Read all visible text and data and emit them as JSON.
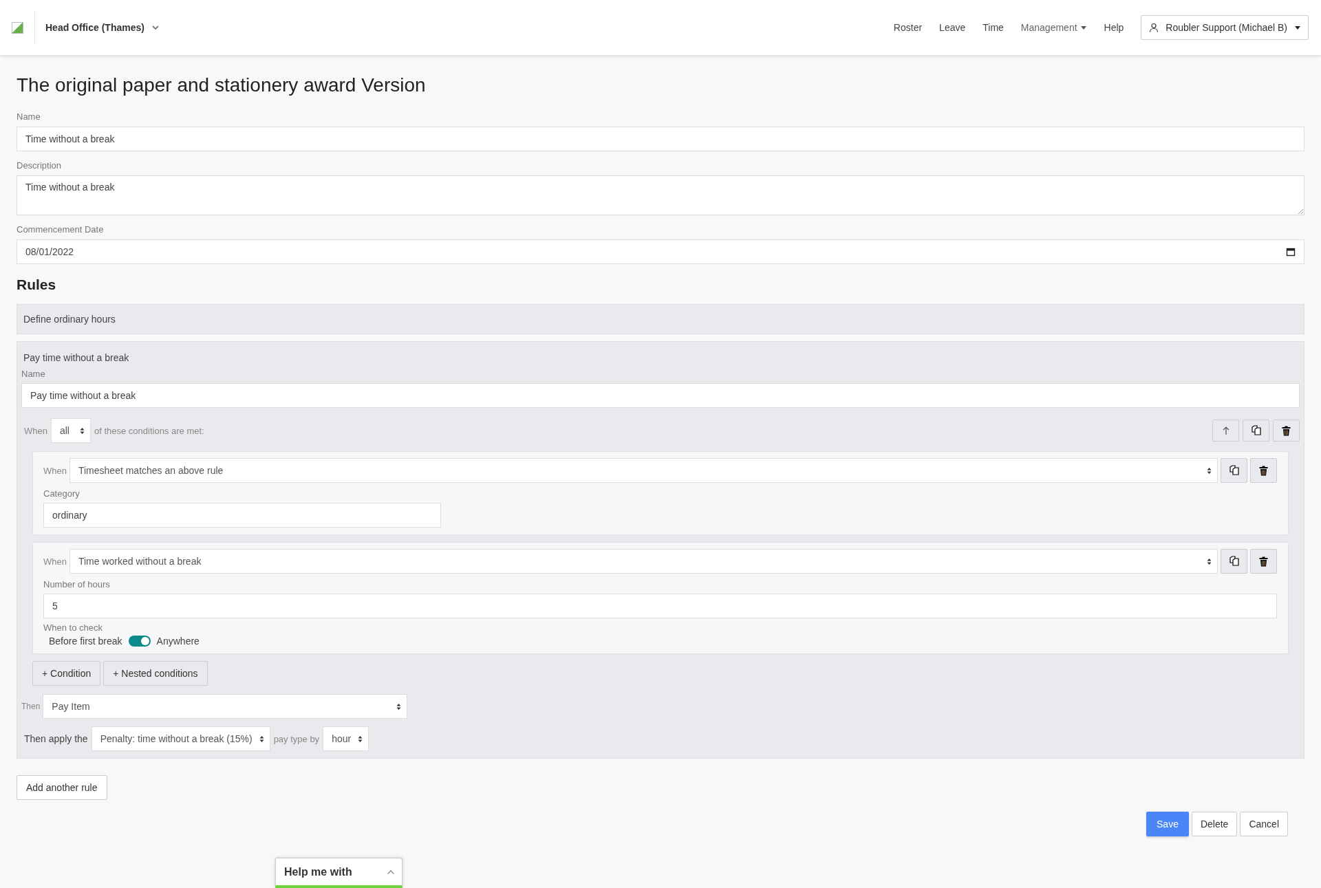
{
  "header": {
    "location": "Head Office (Thames)",
    "nav": [
      {
        "label": "Roster",
        "dropdown": false
      },
      {
        "label": "Leave",
        "dropdown": false
      },
      {
        "label": "Time",
        "dropdown": false
      },
      {
        "label": "Management",
        "dropdown": true
      },
      {
        "label": "Help",
        "dropdown": false
      }
    ],
    "user": "Roubler Support (Michael B)"
  },
  "title": "The original paper and stationery award Version",
  "fields": [
    {
      "kind": "text",
      "label": "Name",
      "value": "Time without a break"
    },
    {
      "kind": "textarea",
      "label": "Description",
      "value": "Time without a break"
    },
    {
      "kind": "date",
      "label": "Commencement Date",
      "value": "08/01/2022"
    }
  ],
  "rules_heading": "Rules",
  "rules": [
    {
      "kind": "collapsed",
      "title": "Define ordinary hours"
    },
    {
      "kind": "expanded",
      "title": "Pay time without a break",
      "name_label": "Name",
      "name_value": "Pay time without a break",
      "match_prefix": "When",
      "match_value": "all",
      "match_suffix": "of these conditions are met:",
      "conditions": [
        {
          "kind": "category",
          "when_label": "When",
          "value": "Timesheet matches an above rule",
          "field_label": "Category",
          "field_value": "ordinary"
        },
        {
          "kind": "hours",
          "when_label": "When",
          "value": "Time worked without a break",
          "field_label": "Number of hours",
          "field_value": "5",
          "check_label": "When to check",
          "toggle": {
            "left": "Before first break",
            "right": "Anywhere",
            "on": true
          }
        }
      ],
      "add_buttons": [
        "+ Condition",
        "+ Nested conditions"
      ],
      "then_label": "Then",
      "then_value": "Pay Item",
      "apply_prefix": "Then apply the",
      "apply_value": "Penalty: time without a break (15%)",
      "apply_mid": "pay type by",
      "apply_unit": "hour"
    }
  ],
  "add_rule": "Add another rule",
  "actions": [
    {
      "label": "Save",
      "kind": "primary"
    },
    {
      "label": "Delete",
      "kind": "default"
    },
    {
      "label": "Cancel",
      "kind": "default"
    }
  ],
  "help_widget": "Help me with"
}
